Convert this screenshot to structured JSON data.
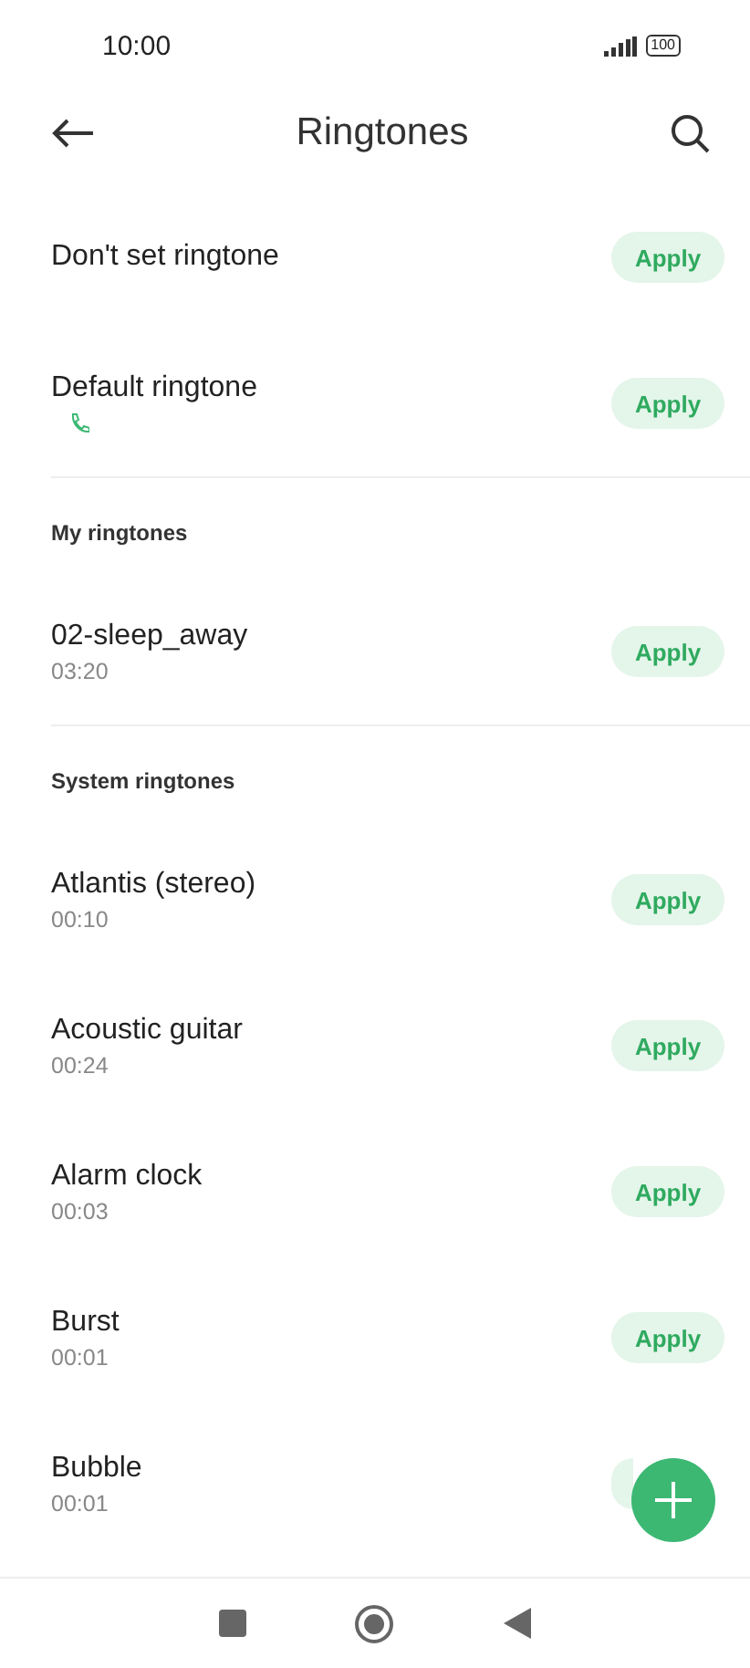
{
  "status_bar": {
    "time": "10:00",
    "battery": "100"
  },
  "header": {
    "title": "Ringtones"
  },
  "sections": [
    {
      "items": [
        {
          "title": "Don't set ringtone",
          "apply": "Apply"
        },
        {
          "title": "Default ringtone",
          "kind": "phone",
          "apply": "Apply"
        }
      ]
    },
    {
      "heading": "My ringtones",
      "items": [
        {
          "title": "02-sleep_away",
          "duration": "03:20",
          "apply": "Apply"
        }
      ]
    },
    {
      "heading": "System ringtones",
      "items": [
        {
          "title": "Atlantis (stereo)",
          "duration": "00:10",
          "apply": "Apply"
        },
        {
          "title": "Acoustic guitar",
          "duration": "00:24",
          "apply": "Apply"
        },
        {
          "title": "Alarm clock",
          "duration": "00:03",
          "apply": "Apply"
        },
        {
          "title": "Burst",
          "duration": "00:01",
          "apply": "Apply"
        },
        {
          "title": "Bubble",
          "duration": "00:01"
        }
      ]
    }
  ]
}
